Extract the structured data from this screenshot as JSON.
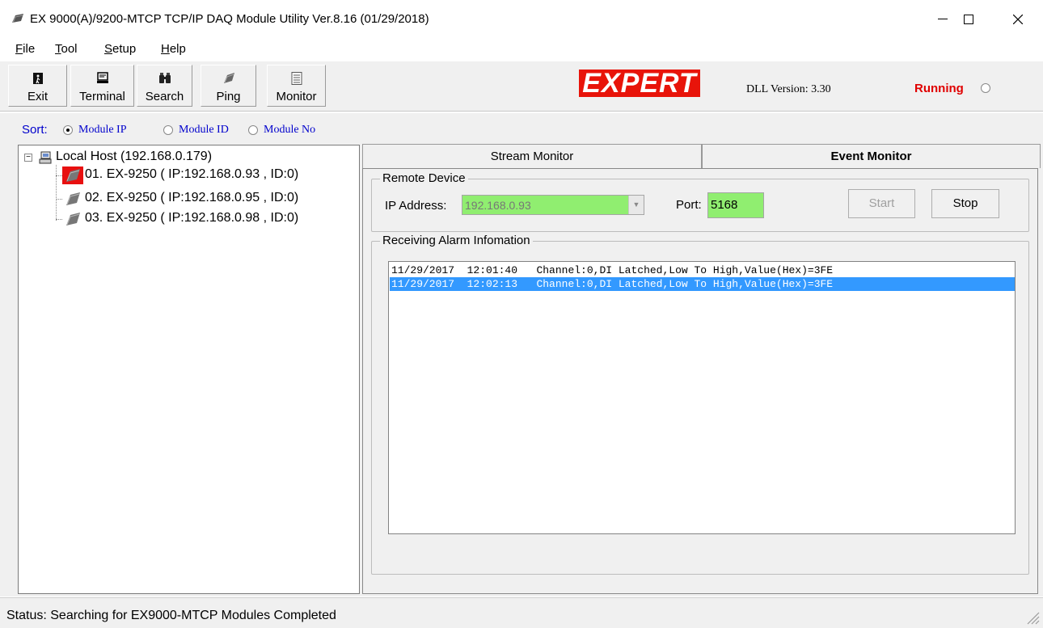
{
  "window": {
    "title": "EX 9000(A)/9200-MTCP TCP/IP DAQ Module Utility Ver.8.16 (01/29/2018)",
    "icon": "module-icon"
  },
  "menu": {
    "items": [
      {
        "label": "File",
        "key": "F"
      },
      {
        "label": "Tool",
        "key": "T"
      },
      {
        "label": "Setup",
        "key": "S"
      },
      {
        "label": "Help",
        "key": "H"
      }
    ]
  },
  "toolbar": {
    "buttons": [
      {
        "label": "Exit",
        "icon": "exit-icon"
      },
      {
        "label": "Terminal",
        "icon": "terminal-icon"
      },
      {
        "label": "Search",
        "icon": "binoculars-icon"
      },
      {
        "label": "Ping",
        "icon": "module-icon"
      },
      {
        "label": "Monitor",
        "icon": "monitor-icon"
      }
    ],
    "logo": "EXPERT",
    "dll_version": "DLL Version: 3.30",
    "running": "Running"
  },
  "sort": {
    "label": "Sort:",
    "options": [
      "Module IP",
      "Module ID",
      "Module No"
    ],
    "selected": "Module IP"
  },
  "tree": {
    "root": "Local Host (192.168.0.179)",
    "items": [
      "01. EX-9250 ( IP:192.168.0.93 , ID:0)",
      "02. EX-9250 ( IP:192.168.0.95 , ID:0)",
      "03. EX-9250 ( IP:192.168.0.98 , ID:0)"
    ]
  },
  "tabs": {
    "stream": "Stream Monitor",
    "event": "Event Monitor",
    "active": "Event Monitor"
  },
  "remote": {
    "group_title": "Remote Device",
    "ip_label": "IP Address:",
    "ip_value": "192.168.0.93",
    "port_label": "Port:",
    "port_value": "5168",
    "start_label": "Start",
    "stop_label": "Stop"
  },
  "alarm": {
    "group_title": "Receiving Alarm Infomation",
    "rows": [
      {
        "date": "11/29/2017",
        "time": "12:01:40",
        "message": "Channel:0,DI Latched,Low To High,Value(Hex)=3FE"
      },
      {
        "date": "11/29/2017",
        "time": "12:02:13",
        "message": "Channel:0,DI Latched,Low To High,Value(Hex)=3FE"
      }
    ]
  },
  "status": {
    "text": "Status: Searching for EX9000-MTCP Modules Completed"
  },
  "colors": {
    "logo_bg": "#e8140a",
    "running": "#e00000",
    "highlight": "#3399ff",
    "field_green": "#90ee70",
    "sort_blue": "#0000cc"
  }
}
